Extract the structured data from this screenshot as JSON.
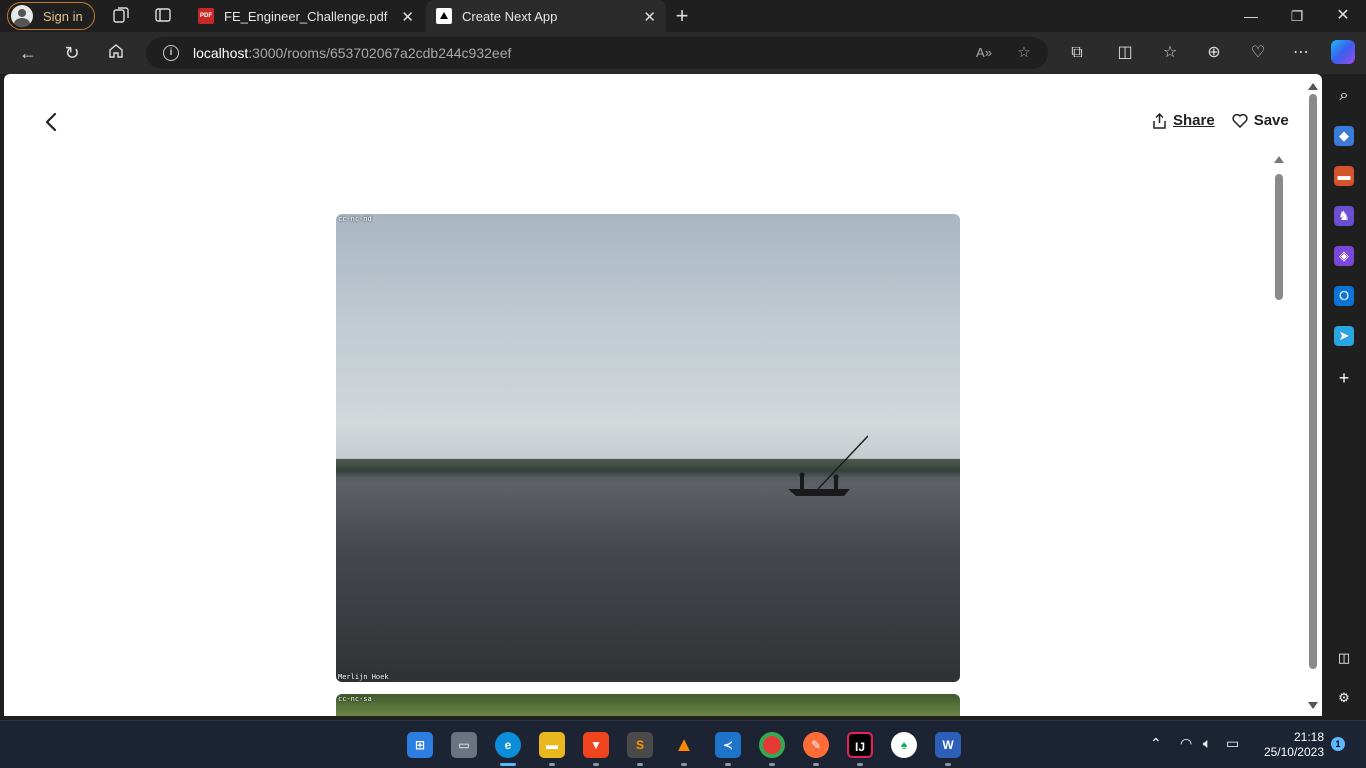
{
  "browser": {
    "signin_label": "Sign in",
    "tabs": [
      {
        "title": "FE_Engineer_Challenge.pdf",
        "favicon": "pdf-icon",
        "favicon_text": "PDF"
      },
      {
        "title": "Create Next App",
        "favicon": "nextjs-icon"
      }
    ],
    "url": {
      "host": "localhost",
      "path": ":3000/rooms/653702067a2cdb244c932eef"
    }
  },
  "page": {
    "share_label": "Share",
    "save_label": "Save",
    "photos": [
      {
        "license": "cc-nc-nd",
        "credit": "Merlijn Hoek",
        "subject": "lake with boat"
      },
      {
        "license": "cc-nc-sa",
        "subject": "greenery"
      }
    ]
  },
  "sidebar": {
    "items": [
      "search-icon",
      "tag-icon",
      "toolbox-icon",
      "chess-icon",
      "office-icon",
      "outlook-icon",
      "telegram-icon",
      "add-icon",
      "split-screen-icon",
      "settings-icon"
    ]
  },
  "taskbar": {
    "apps": [
      "windows-start",
      "task-view",
      "edge",
      "file-explorer",
      "brave",
      "sublime-text",
      "vlc",
      "vscode",
      "chrome",
      "postman",
      "intellij",
      "mongodb-compass",
      "word"
    ],
    "time": "21:18",
    "date": "25/10/2023",
    "notification_count": "1"
  },
  "colors": {
    "accent": "#c87a2a",
    "taskbar": "#1c2333",
    "edge_blue": "#5cb8ff"
  }
}
